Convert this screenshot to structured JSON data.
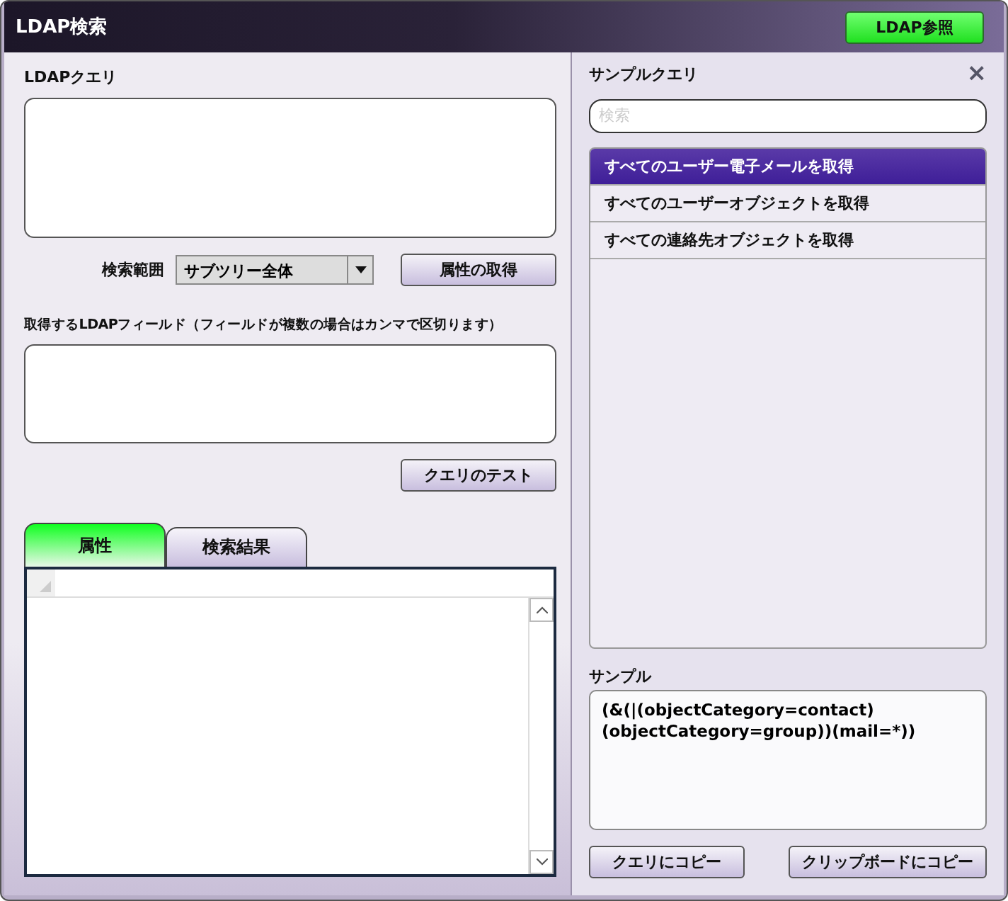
{
  "window": {
    "title": "LDAP検索",
    "browse_button": "LDAP参照"
  },
  "query": {
    "label": "LDAPクエリ"
  },
  "scope": {
    "label": "検索範囲",
    "value": "サブツリー全体",
    "get_attributes_button": "属性の取得"
  },
  "fields": {
    "label": "取得するLDAPフィールド（フィールドが複数の場合はカンマで区切ります）",
    "test_button": "クエリのテスト"
  },
  "tabs": [
    {
      "label": "属性",
      "selected": true
    },
    {
      "label": "検索結果",
      "selected": false
    }
  ],
  "samples": {
    "title": "サンプルクエリ",
    "close": "×",
    "search_placeholder": "検索",
    "items": [
      {
        "label": "すべてのユーザー電子メールを取得",
        "selected": true
      },
      {
        "label": "すべてのユーザーオブジェクトを取得",
        "selected": false
      },
      {
        "label": "すべての連絡先オブジェクトを取得",
        "selected": false
      }
    ],
    "sample_label": "サンプル",
    "sample_text": "(&(|(objectCategory=contact)\n(objectCategory=group))(mail=*))",
    "copy_query_button": "クエリにコピー",
    "copy_clipboard_button": "クリップボードにコピー"
  }
}
